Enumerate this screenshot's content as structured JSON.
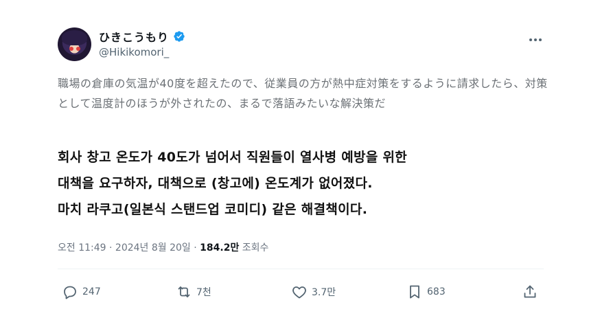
{
  "user": {
    "display_name": "ひきこうもり",
    "handle": "@Hikikomori_",
    "verified_color": "#1d9bf0"
  },
  "tweet": {
    "original_text": "職場の倉庫の気温が40度を超えたので、従業員の方が熱中症対策をするように請求したら、対策として温度計のほうが外されたの、まるで落語みたいな解決策だ",
    "translation_lines": [
      "회사 창고 온도가 40도가 넘어서 직원들이 열사병 예방을 위한",
      "대책을 요구하자, 대책으로 (창고에) 온도계가 없어졌다.",
      "마치 라쿠고(일본식 스탠드업 코미디) 같은 해결책이다."
    ]
  },
  "meta": {
    "timestamp": "오전 11:49 · 2024년 8월 20일 · ",
    "views_count": "184.2만",
    "views_label": " 조회수"
  },
  "actions": {
    "reply_count": "247",
    "retweet_count": "7천",
    "like_count": "3.7만",
    "bookmark_count": "683"
  },
  "icons": [
    "more-icon",
    "verified-icon",
    "reply-icon",
    "retweet-icon",
    "like-icon",
    "bookmark-icon",
    "share-icon"
  ]
}
